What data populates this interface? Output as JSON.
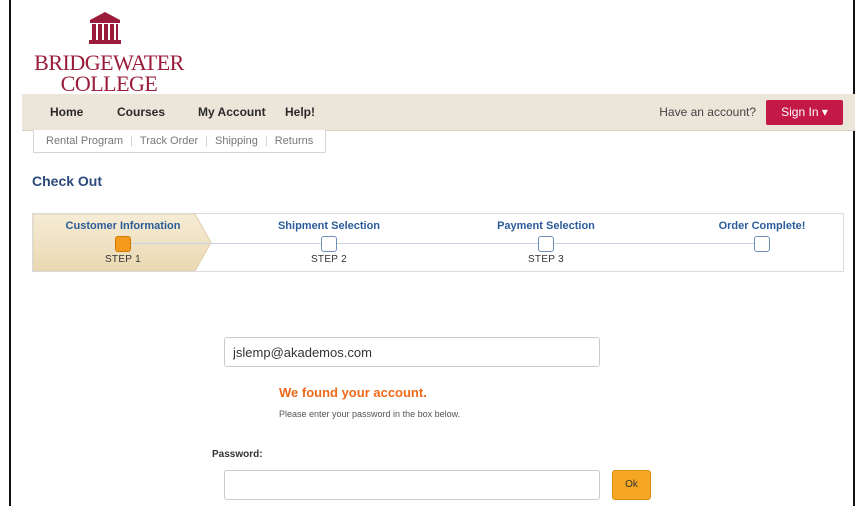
{
  "brand": {
    "line1": "BRIDGEWATER",
    "line2": "COLLEGE",
    "color": "#9b1c3a"
  },
  "nav": {
    "items": [
      {
        "label": "Home"
      },
      {
        "label": "Courses"
      },
      {
        "label": "My Account"
      },
      {
        "label": "Help!"
      }
    ],
    "have_account": "Have an account?",
    "sign_in": "Sign In ▾",
    "sign_in_color": "#c41846"
  },
  "subnav": {
    "items": [
      "Rental Program",
      "Track Order",
      "Shipping",
      "Returns"
    ]
  },
  "page": {
    "title": "Check Out"
  },
  "steps": [
    {
      "title": "Customer Information",
      "step": "STEP 1",
      "active": true
    },
    {
      "title": "Shipment Selection",
      "step": "STEP 2",
      "active": false
    },
    {
      "title": "Payment Selection",
      "step": "STEP 3",
      "active": false
    },
    {
      "title": "Order Complete!",
      "step": "",
      "active": false
    }
  ],
  "form": {
    "email_value": "jslemp@akademos.com",
    "found_message": "We found your account.",
    "instruction": "Please enter your password in the box below.",
    "password_label": "Password:",
    "password_value": "",
    "ok_label": "Ok",
    "ok_color": "#f5a623"
  }
}
